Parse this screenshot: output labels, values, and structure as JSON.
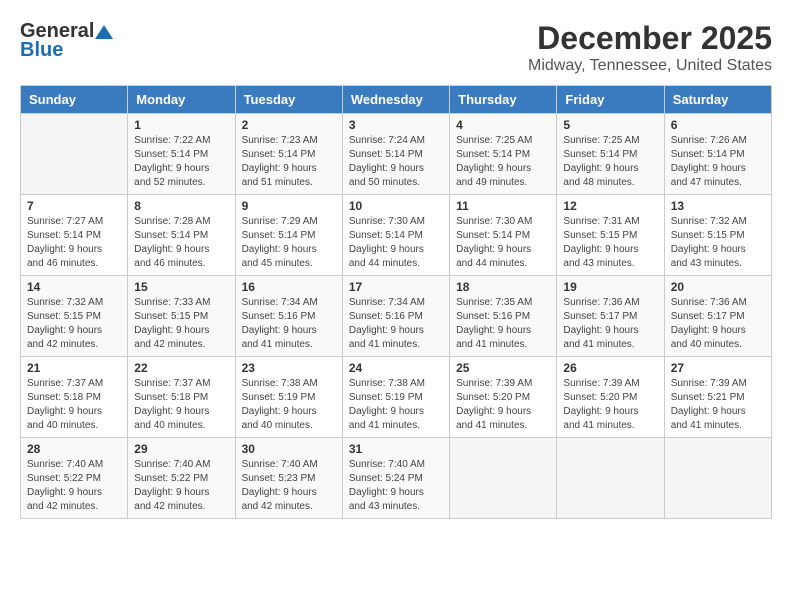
{
  "logo": {
    "general": "General",
    "blue": "Blue"
  },
  "title": "December 2025",
  "subtitle": "Midway, Tennessee, United States",
  "days_of_week": [
    "Sunday",
    "Monday",
    "Tuesday",
    "Wednesday",
    "Thursday",
    "Friday",
    "Saturday"
  ],
  "weeks": [
    [
      {
        "day": "",
        "content": ""
      },
      {
        "day": "1",
        "content": "Sunrise: 7:22 AM\nSunset: 5:14 PM\nDaylight: 9 hours\nand 52 minutes."
      },
      {
        "day": "2",
        "content": "Sunrise: 7:23 AM\nSunset: 5:14 PM\nDaylight: 9 hours\nand 51 minutes."
      },
      {
        "day": "3",
        "content": "Sunrise: 7:24 AM\nSunset: 5:14 PM\nDaylight: 9 hours\nand 50 minutes."
      },
      {
        "day": "4",
        "content": "Sunrise: 7:25 AM\nSunset: 5:14 PM\nDaylight: 9 hours\nand 49 minutes."
      },
      {
        "day": "5",
        "content": "Sunrise: 7:25 AM\nSunset: 5:14 PM\nDaylight: 9 hours\nand 48 minutes."
      },
      {
        "day": "6",
        "content": "Sunrise: 7:26 AM\nSunset: 5:14 PM\nDaylight: 9 hours\nand 47 minutes."
      }
    ],
    [
      {
        "day": "7",
        "content": "Sunrise: 7:27 AM\nSunset: 5:14 PM\nDaylight: 9 hours\nand 46 minutes."
      },
      {
        "day": "8",
        "content": "Sunrise: 7:28 AM\nSunset: 5:14 PM\nDaylight: 9 hours\nand 46 minutes."
      },
      {
        "day": "9",
        "content": "Sunrise: 7:29 AM\nSunset: 5:14 PM\nDaylight: 9 hours\nand 45 minutes."
      },
      {
        "day": "10",
        "content": "Sunrise: 7:30 AM\nSunset: 5:14 PM\nDaylight: 9 hours\nand 44 minutes."
      },
      {
        "day": "11",
        "content": "Sunrise: 7:30 AM\nSunset: 5:14 PM\nDaylight: 9 hours\nand 44 minutes."
      },
      {
        "day": "12",
        "content": "Sunrise: 7:31 AM\nSunset: 5:15 PM\nDaylight: 9 hours\nand 43 minutes."
      },
      {
        "day": "13",
        "content": "Sunrise: 7:32 AM\nSunset: 5:15 PM\nDaylight: 9 hours\nand 43 minutes."
      }
    ],
    [
      {
        "day": "14",
        "content": "Sunrise: 7:32 AM\nSunset: 5:15 PM\nDaylight: 9 hours\nand 42 minutes."
      },
      {
        "day": "15",
        "content": "Sunrise: 7:33 AM\nSunset: 5:15 PM\nDaylight: 9 hours\nand 42 minutes."
      },
      {
        "day": "16",
        "content": "Sunrise: 7:34 AM\nSunset: 5:16 PM\nDaylight: 9 hours\nand 41 minutes."
      },
      {
        "day": "17",
        "content": "Sunrise: 7:34 AM\nSunset: 5:16 PM\nDaylight: 9 hours\nand 41 minutes."
      },
      {
        "day": "18",
        "content": "Sunrise: 7:35 AM\nSunset: 5:16 PM\nDaylight: 9 hours\nand 41 minutes."
      },
      {
        "day": "19",
        "content": "Sunrise: 7:36 AM\nSunset: 5:17 PM\nDaylight: 9 hours\nand 41 minutes."
      },
      {
        "day": "20",
        "content": "Sunrise: 7:36 AM\nSunset: 5:17 PM\nDaylight: 9 hours\nand 40 minutes."
      }
    ],
    [
      {
        "day": "21",
        "content": "Sunrise: 7:37 AM\nSunset: 5:18 PM\nDaylight: 9 hours\nand 40 minutes."
      },
      {
        "day": "22",
        "content": "Sunrise: 7:37 AM\nSunset: 5:18 PM\nDaylight: 9 hours\nand 40 minutes."
      },
      {
        "day": "23",
        "content": "Sunrise: 7:38 AM\nSunset: 5:19 PM\nDaylight: 9 hours\nand 40 minutes."
      },
      {
        "day": "24",
        "content": "Sunrise: 7:38 AM\nSunset: 5:19 PM\nDaylight: 9 hours\nand 41 minutes."
      },
      {
        "day": "25",
        "content": "Sunrise: 7:39 AM\nSunset: 5:20 PM\nDaylight: 9 hours\nand 41 minutes."
      },
      {
        "day": "26",
        "content": "Sunrise: 7:39 AM\nSunset: 5:20 PM\nDaylight: 9 hours\nand 41 minutes."
      },
      {
        "day": "27",
        "content": "Sunrise: 7:39 AM\nSunset: 5:21 PM\nDaylight: 9 hours\nand 41 minutes."
      }
    ],
    [
      {
        "day": "28",
        "content": "Sunrise: 7:40 AM\nSunset: 5:22 PM\nDaylight: 9 hours\nand 42 minutes."
      },
      {
        "day": "29",
        "content": "Sunrise: 7:40 AM\nSunset: 5:22 PM\nDaylight: 9 hours\nand 42 minutes."
      },
      {
        "day": "30",
        "content": "Sunrise: 7:40 AM\nSunset: 5:23 PM\nDaylight: 9 hours\nand 42 minutes."
      },
      {
        "day": "31",
        "content": "Sunrise: 7:40 AM\nSunset: 5:24 PM\nDaylight: 9 hours\nand 43 minutes."
      },
      {
        "day": "",
        "content": ""
      },
      {
        "day": "",
        "content": ""
      },
      {
        "day": "",
        "content": ""
      }
    ]
  ]
}
